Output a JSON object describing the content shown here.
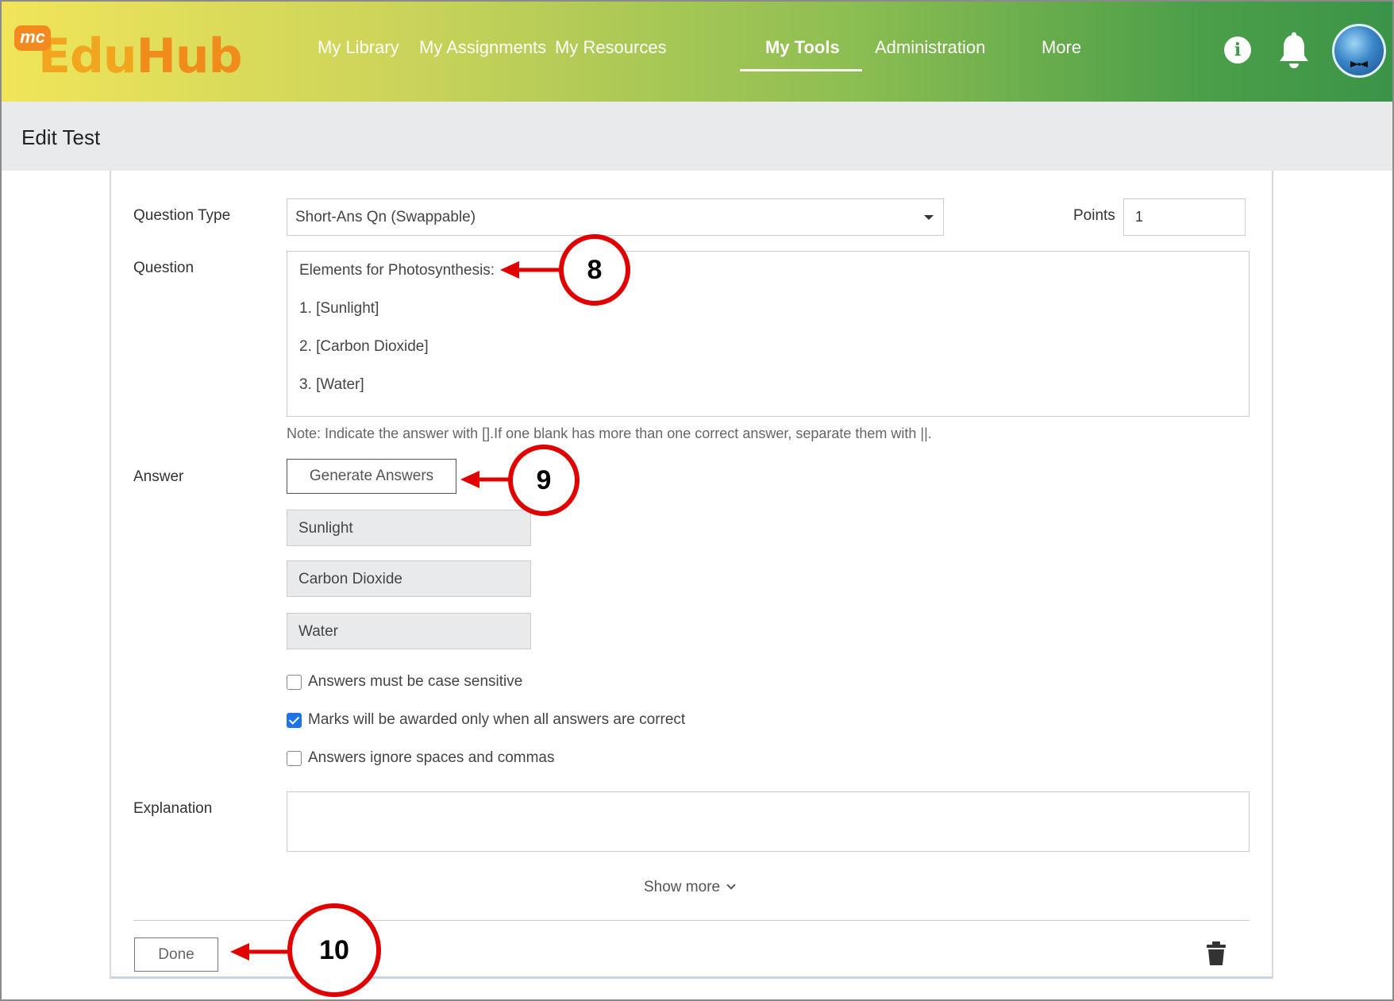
{
  "logo": {
    "badge": "mc",
    "text_a": "Edu",
    "text_b": "Hub"
  },
  "nav": {
    "items": [
      "My Library",
      "My Assignments",
      "My Resources",
      "My Tools",
      "Administration",
      "More"
    ],
    "active": "My Tools"
  },
  "header_icons": [
    "info-icon",
    "bell-icon",
    "avatar"
  ],
  "page_title": "Edit Test",
  "form": {
    "question_type_label": "Question Type",
    "question_type_value": "Short-Ans Qn (Swappable)",
    "points_label": "Points",
    "points_value": "1",
    "question_label": "Question",
    "question_lines": [
      "Elements for Photosynthesis:",
      "1. [Sunlight]",
      "2. [Carbon Dioxide]",
      "3. [Water]"
    ],
    "note": "Note: Indicate the answer with [].If one blank has more than one correct answer, separate them with ||.",
    "answer_label": "Answer",
    "generate_button": "Generate Answers",
    "answers": [
      "Sunlight",
      "Carbon Dioxide",
      "Water"
    ],
    "options": [
      {
        "label": "Answers must be case sensitive",
        "checked": false
      },
      {
        "label": "Marks will be awarded only when all answers are correct",
        "checked": true
      },
      {
        "label": "Answers ignore spaces and commas",
        "checked": false
      }
    ],
    "explanation_label": "Explanation",
    "explanation_value": "",
    "show_more": "Show more",
    "done_button": "Done"
  },
  "callouts": [
    "8",
    "9",
    "10"
  ],
  "colors": {
    "header_gradient_start": "#f0e55a",
    "header_gradient_end": "#3a9448",
    "callout_red": "#e00000",
    "checkbox_blue": "#1e73e6"
  }
}
